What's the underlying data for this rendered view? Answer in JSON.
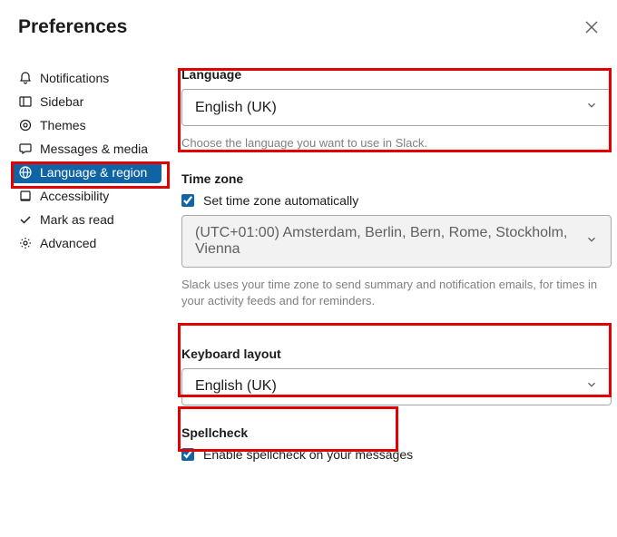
{
  "header": {
    "title": "Preferences"
  },
  "sidebar": {
    "items": [
      {
        "label": "Notifications"
      },
      {
        "label": "Sidebar"
      },
      {
        "label": "Themes"
      },
      {
        "label": "Messages & media"
      },
      {
        "label": "Language & region"
      },
      {
        "label": "Accessibility"
      },
      {
        "label": "Mark as read"
      },
      {
        "label": "Advanced"
      }
    ]
  },
  "content": {
    "language": {
      "title": "Language",
      "value": "English (UK)",
      "helper": "Choose the language you want to use in Slack."
    },
    "timezone": {
      "title": "Time zone",
      "auto_label": "Set time zone automatically",
      "auto_checked": true,
      "value": "(UTC+01:00) Amsterdam, Berlin, Bern, Rome, Stockholm, Vienna",
      "helper": "Slack uses your time zone to send summary and notification emails, for times in your activity feeds and for reminders."
    },
    "keyboard": {
      "title": "Keyboard layout",
      "value": "English (UK)"
    },
    "spellcheck": {
      "title": "Spellcheck",
      "label": "Enable spellcheck on your messages",
      "checked": true
    }
  }
}
